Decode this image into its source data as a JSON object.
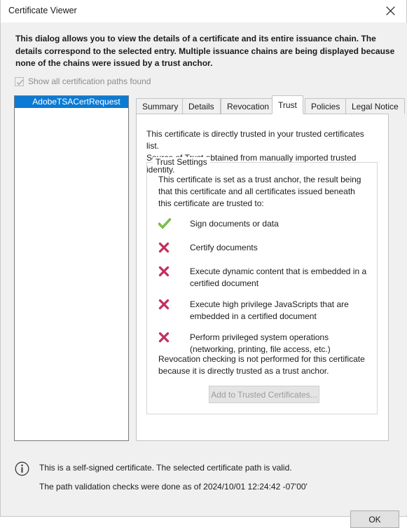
{
  "window": {
    "title": "Certificate Viewer",
    "close_icon": "close-icon"
  },
  "intro": {
    "text": "This dialog allows you to view the details of a certificate and its entire issuance chain. The details correspond to the selected entry. Multiple issuance chains are being displayed because none of the chains were issued by a trust anchor."
  },
  "show_all_paths": {
    "label": "Show all certification paths found",
    "checked": true,
    "enabled": false
  },
  "path_list": {
    "items": [
      {
        "label": "AdobeTSACertRequest",
        "selected": true
      }
    ],
    "selected_color": "#0a7ad4"
  },
  "tabs": [
    {
      "label": "Summary",
      "selected": false
    },
    {
      "label": "Details",
      "selected": false
    },
    {
      "label": "Revocation",
      "selected": false
    },
    {
      "label": "Trust",
      "selected": true
    },
    {
      "label": "Policies",
      "selected": false
    },
    {
      "label": "Legal Notice",
      "selected": false
    }
  ],
  "trust_tab": {
    "summary_line_1": "This certificate is directly trusted in your trusted certificates list.",
    "summary_line_2": "Source of Trust obtained from manually imported trusted identity.",
    "group_title": "Trust Settings",
    "group_intro": "This certificate is set as a trust anchor, the result being that this certificate and all certificates issued beneath this certificate are trusted to:",
    "permissions": [
      {
        "icon": "check-icon",
        "allowed": true,
        "label": "Sign documents or data"
      },
      {
        "icon": "cross-icon",
        "allowed": false,
        "label": "Certify documents"
      },
      {
        "icon": "cross-icon",
        "allowed": false,
        "label": "Execute dynamic content that is embedded in a certified document"
      },
      {
        "icon": "cross-icon",
        "allowed": false,
        "label": "Execute high privilege JavaScripts that are embedded in a certified document"
      },
      {
        "icon": "cross-icon",
        "allowed": false,
        "label": "Perform privileged system operations (networking, printing, file access, etc.)"
      }
    ],
    "revocation_note": "Revocation checking is not performed for this certificate because it is directly trusted as a trust anchor.",
    "add_trusted_button": {
      "label": "Add to Trusted Certificates...",
      "enabled": false
    }
  },
  "footer": {
    "info_icon": "info-icon",
    "line_1": "This is a self-signed certificate. The selected certificate path is valid.",
    "line_2": "The path validation checks were done as of 2024/10/01 12:24:42 -07'00'",
    "ok_label": "OK"
  },
  "colors": {
    "accent_blue": "#0a7ad4",
    "allow_green": "#5fb529",
    "deny_crimson": "#c2305c",
    "dialog_bg": "#f0f0f0",
    "panel_bg": "#ffffff"
  }
}
